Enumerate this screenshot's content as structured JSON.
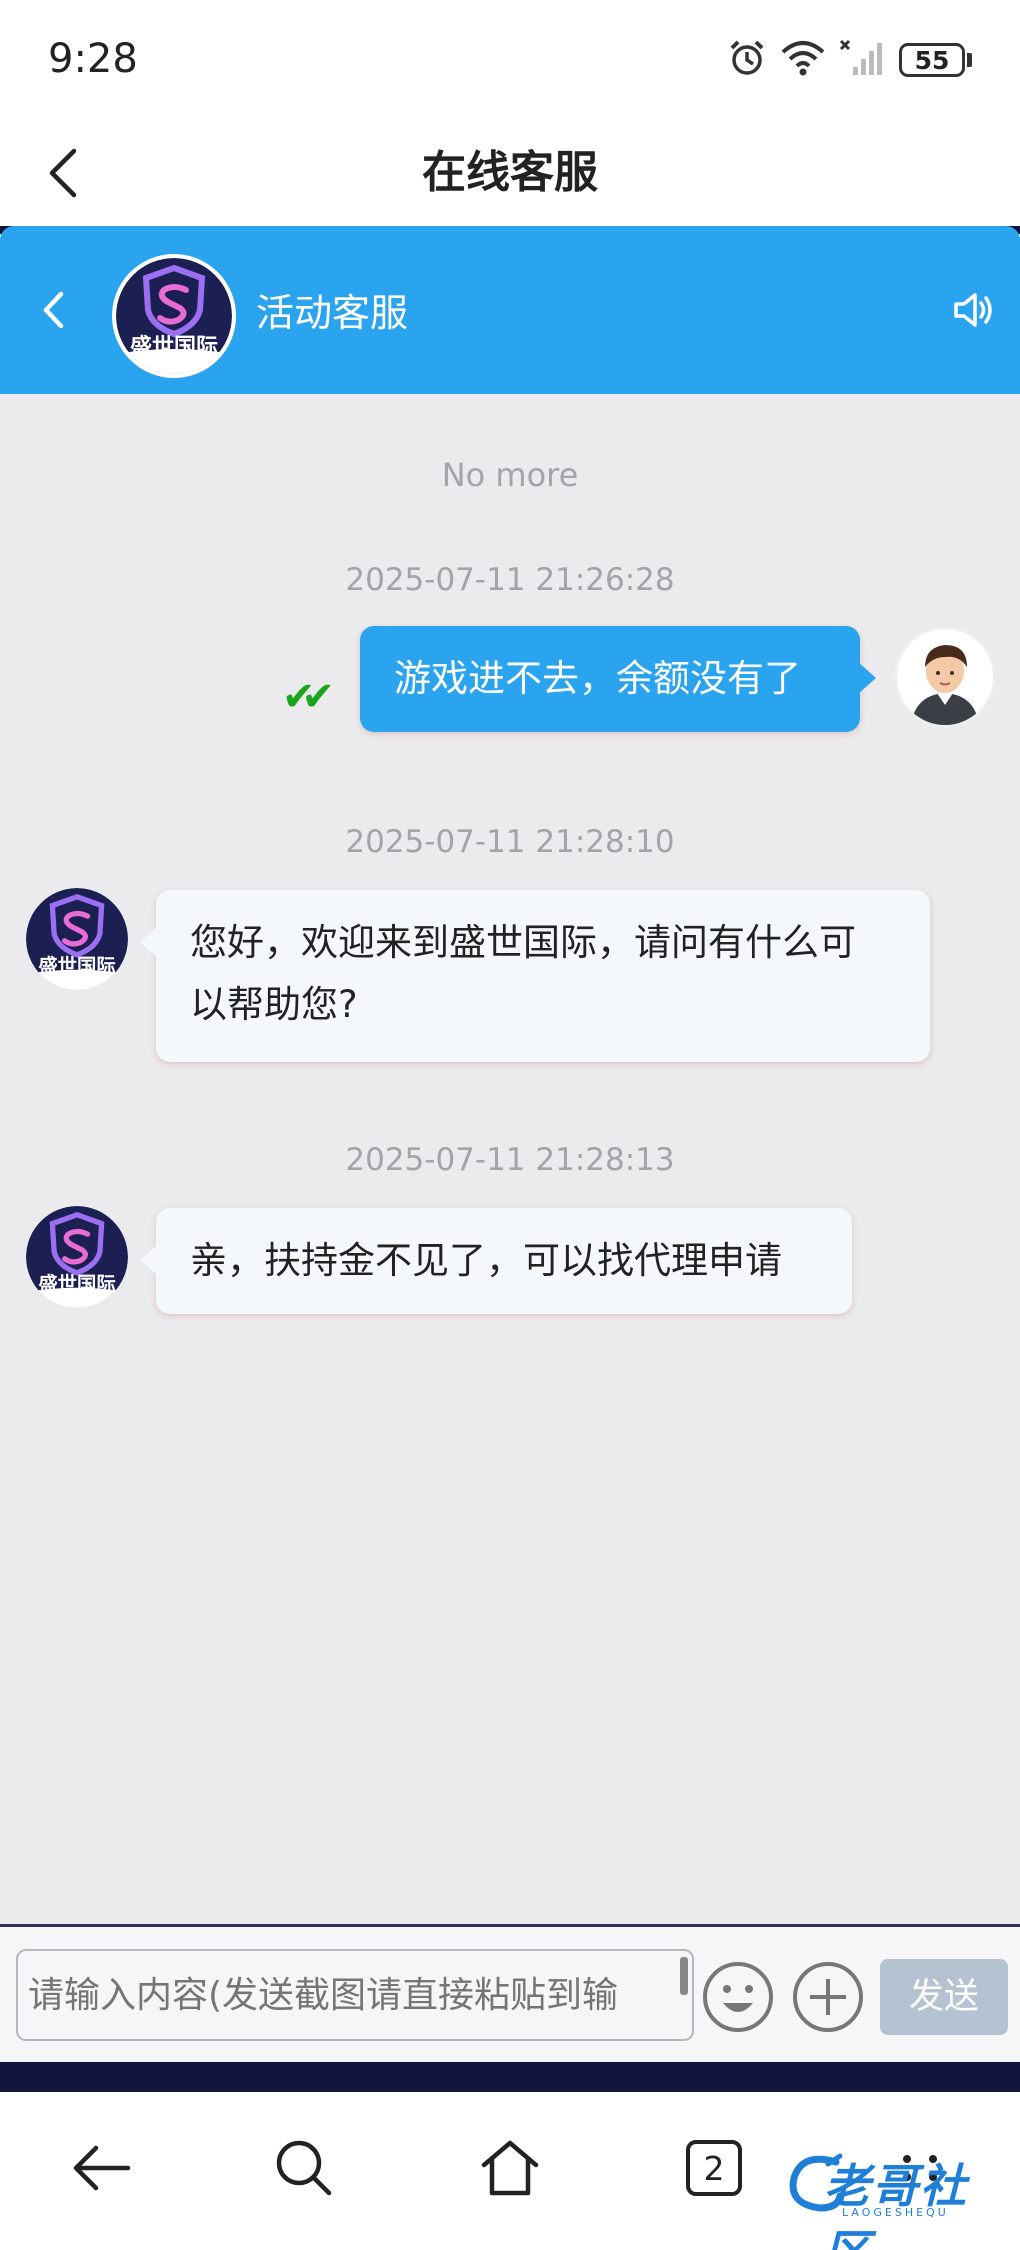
{
  "status_bar": {
    "time": "9:28",
    "battery": "55",
    "icons": [
      "alarm-icon",
      "wifi-icon",
      "no-signal-icon",
      "battery-icon"
    ]
  },
  "title_bar": {
    "title": "在线客服"
  },
  "chat_header": {
    "name": "活动客服",
    "avatar_logo_text": "盛世国际",
    "accent_color": "#2aa4ef"
  },
  "chat": {
    "no_more": "No more",
    "messages": [
      {
        "timestamp": "2025-07-11 21:26:28",
        "direction": "outgoing",
        "read": true,
        "lines": [
          "游戏进不去，余额没有了"
        ]
      },
      {
        "timestamp": "2025-07-11 21:28:10",
        "direction": "incoming",
        "lines": [
          "您好，欢迎来到盛世国际，请问有什么可",
          "以帮助您?"
        ]
      },
      {
        "timestamp": "2025-07-11 21:28:13",
        "direction": "incoming",
        "lines": [
          "亲，扶持金不见了，可以找代理申请"
        ]
      }
    ]
  },
  "input_bar": {
    "placeholder": "请输入内容(发送截图请直接粘贴到输",
    "send_label": "发送"
  },
  "browser_nav": {
    "tab_count": "2",
    "watermark": "老哥社区",
    "watermark_sub": "LAOGESHEQU"
  },
  "colors": {
    "chat_background": "#ebeaec",
    "outgoing_bubble": "#2aa4ef",
    "incoming_bubble": "#f4f8fb",
    "dark_strip": "#13143d",
    "read_check": "#1aa51a"
  }
}
